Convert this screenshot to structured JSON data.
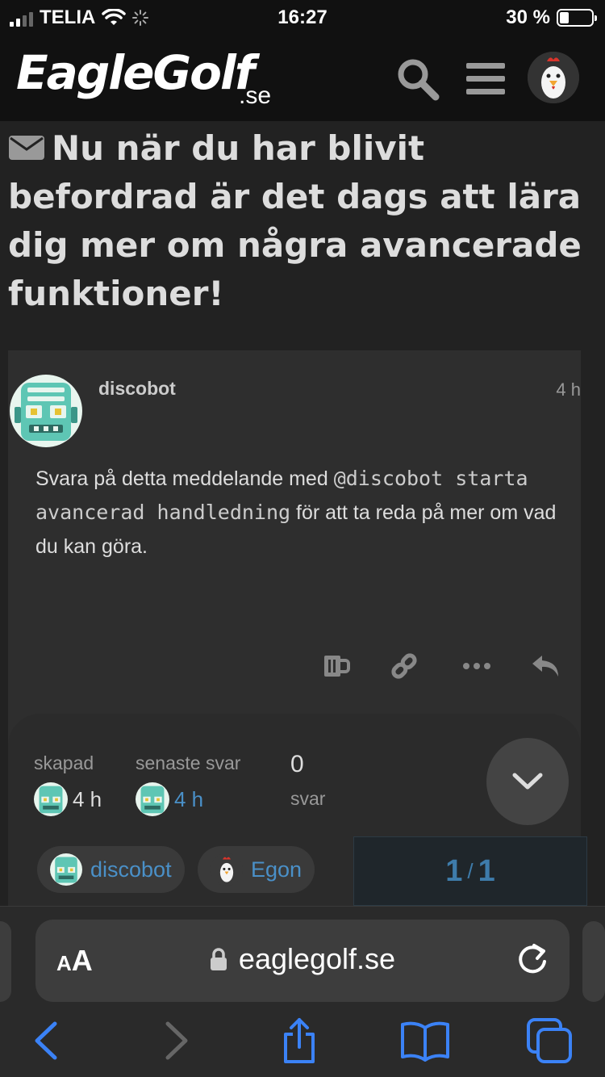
{
  "status_bar": {
    "carrier": "TELIA",
    "time": "16:27",
    "battery": "30 %",
    "battery_level": 0.3
  },
  "header": {
    "logo_text": "EagleGolf",
    "logo_suffix": ".se",
    "icons": [
      "search-icon",
      "hamburger-menu-icon",
      "user-avatar"
    ]
  },
  "topic": {
    "title": "Nu när du har blivit befordrad är det dags att lära dig mer om några avancerade funktioner!",
    "title_icon": "envelope-icon"
  },
  "post": {
    "username": "discobot",
    "date": "4 h",
    "body_before": "Svara på detta meddelande med ",
    "body_code": "@discobot starta avancerad handledning",
    "body_after": " för att ta reda på mer om vad du kan göra.",
    "actions": [
      "like-icon",
      "link-icon",
      "more-icon",
      "reply-icon"
    ]
  },
  "topic_map": {
    "created_label": "skapad",
    "created_value": "4 h",
    "last_reply_label": "senaste svar",
    "last_reply_value": "4 h",
    "replies_count": "0",
    "replies_label": "svar",
    "participants": [
      {
        "name": "discobot"
      },
      {
        "name": "Egon"
      }
    ]
  },
  "progress": {
    "current": "1",
    "sep": "/",
    "total": "1"
  },
  "safari": {
    "aa_label": "A",
    "aa_big": "A",
    "url": "eaglegolf.se"
  },
  "colors": {
    "background": "#222222",
    "header": "#111111",
    "link": "#4a90c8",
    "safari_blue": "#3b82f6"
  }
}
